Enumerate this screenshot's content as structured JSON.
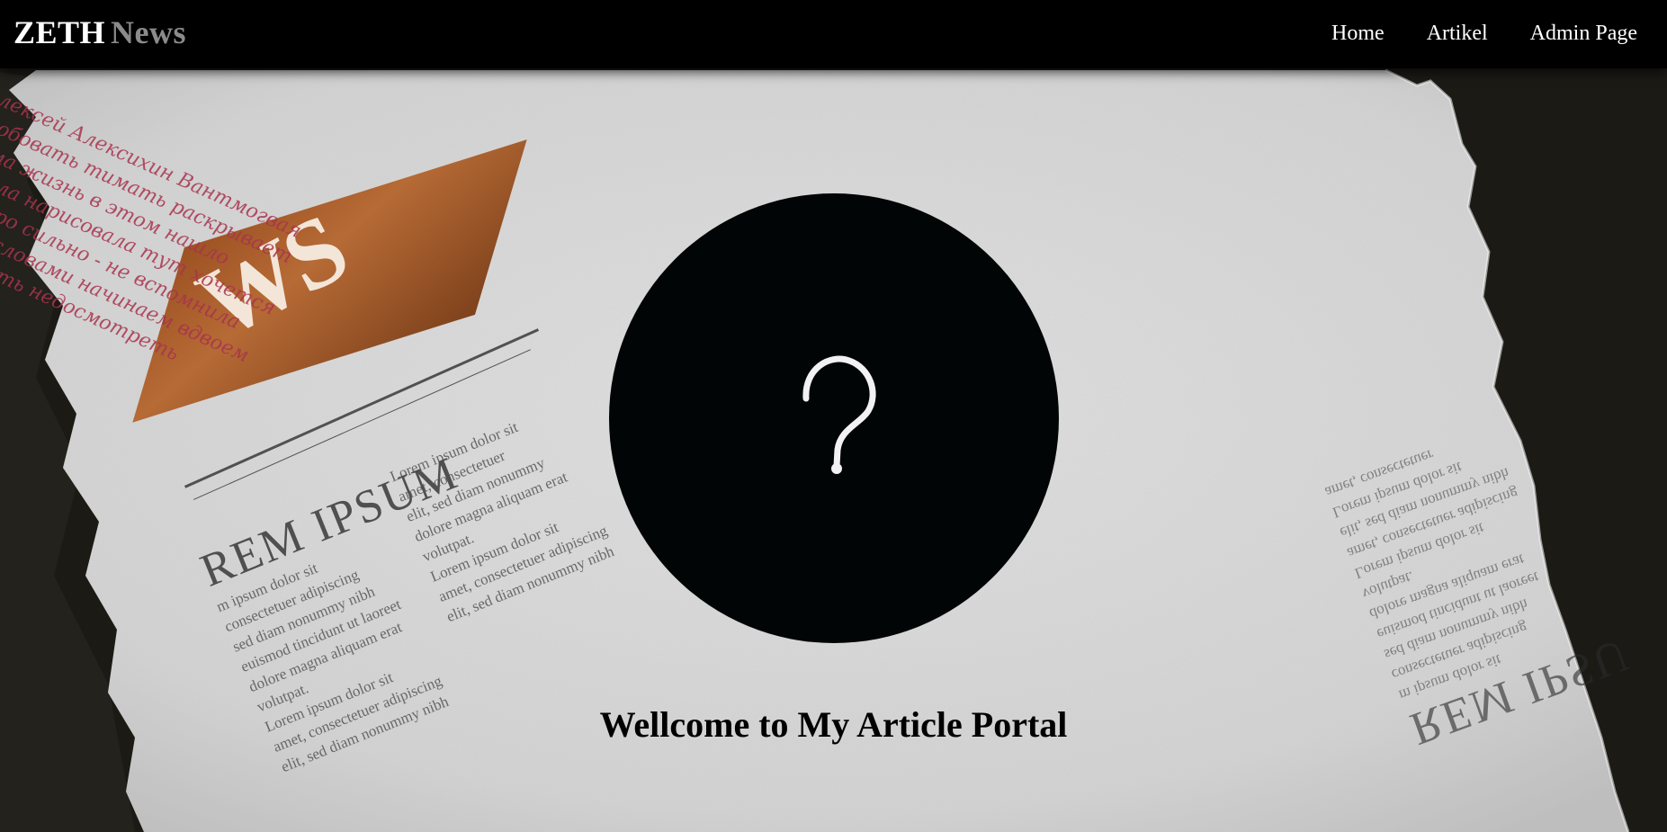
{
  "brand": {
    "part1": "ZETH",
    "part2": "News"
  },
  "nav": {
    "items": [
      {
        "label": "Home"
      },
      {
        "label": "Artikel"
      },
      {
        "label": "Admin Page"
      }
    ]
  },
  "hero": {
    "icon": "question-mark-icon",
    "welcome_text": "Wellcome to My Article Portal"
  },
  "background": {
    "headline_left": "REM IPSUM",
    "headline_right": "REM IPSU",
    "news_tag": "WS",
    "column_text_1": "m ipsum dolor sit",
    "column_text_2": "consectetuer adipiscing",
    "column_text_3": "sed diam nonummy nibh",
    "column_text_4": "euismod tincidunt ut laoreet",
    "column_text_5": "dolore magna aliquam erat",
    "column_text_6": "volutpat.",
    "column_text_7": "Lorem ipsum dolor sit",
    "column_text_8": "amet, consectetuer adipiscing",
    "column_text_9": "elit, sed diam nonummy nibh",
    "column_text_10": "Lorem ipsum dolor sit",
    "column_text_11": "amet, consectetuer",
    "column_text_12": "elit, sed diam nonummy",
    "script_1": "Алексей Алексихин Вантмогвая",
    "script_2": "пробовать тимать раскрывает",
    "script_3": "мама жизнь в этом нашло",
    "script_4": "видела нарисовала тут хочется",
    "script_5": "быстро сильно - не вспомнила",
    "script_6": "перед словами начинаем вдвоем",
    "script_7": "пробовать недосмотреть"
  },
  "colors": {
    "navbar_bg": "#000000",
    "brand_primary": "#ffffff",
    "brand_secondary": "#8b8b8b",
    "hero_circle": "#020505",
    "paper": "#d9d9d9",
    "script_red": "#a8344e",
    "news_tag_orange": "#b5652d"
  }
}
